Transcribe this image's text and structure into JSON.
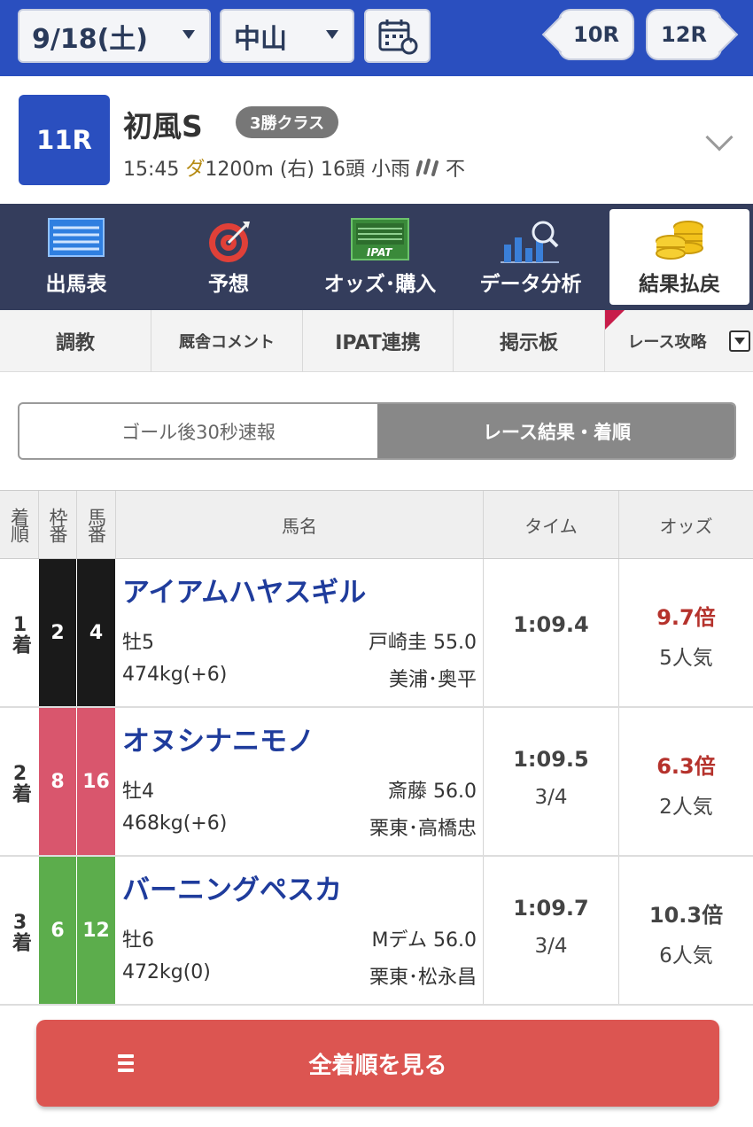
{
  "topbar": {
    "date": "9/18(土)",
    "venue": "中山",
    "prev_race": "10R",
    "next_race": "12R",
    "calendar_icon": "calendar-refresh-icon"
  },
  "race": {
    "number": "11R",
    "name": "初風S",
    "class": "3勝クラス",
    "time": "15:45",
    "surface": "ダ",
    "distance": "1200m (右)",
    "runners": "16頭",
    "weather": "小雨",
    "weather_icon": "rain-icon",
    "track": "不"
  },
  "main_nav": [
    {
      "label": "出馬表",
      "icon": "entry-table-icon"
    },
    {
      "label": "予想",
      "icon": "target-icon"
    },
    {
      "label": "オッズ･購入",
      "icon": "ipat-icon"
    },
    {
      "label": "データ分析",
      "icon": "chart-magnifier-icon"
    },
    {
      "label": "結果払戻",
      "icon": "coins-icon",
      "active": true
    }
  ],
  "sub_nav": [
    "調教",
    "厩舎コメント",
    "IPAT連携",
    "掲示板",
    "レース攻略"
  ],
  "toggle": {
    "left": "ゴール後30秒速報",
    "right": "レース結果・着順"
  },
  "table": {
    "headers": {
      "position": "着順",
      "waku": "枠番",
      "umaban": "馬番",
      "horse": "馬名",
      "time": "タイム",
      "odds": "オッズ"
    },
    "rows": [
      {
        "position": "1着",
        "waku": "2",
        "umaban": "4",
        "horse": "アイアムハヤスギル",
        "sex_age": "牡5",
        "weight": "474kg(+6)",
        "jockey": "戸崎圭 55.0",
        "trainer": "美浦･奥平",
        "time": "1:09.4",
        "margin": "",
        "odds": "9.7倍",
        "popularity": "5人気"
      },
      {
        "position": "2着",
        "waku": "8",
        "umaban": "16",
        "horse": "オヌシナニモノ",
        "sex_age": "牡4",
        "weight": "468kg(+6)",
        "jockey": "斎藤 56.0",
        "trainer": "栗東･高橋忠",
        "time": "1:09.5",
        "margin": "3/4",
        "odds": "6.3倍",
        "popularity": "2人気"
      },
      {
        "position": "3着",
        "waku": "6",
        "umaban": "12",
        "horse": "バーニングペスカ",
        "sex_age": "牡6",
        "weight": "472kg(0)",
        "jockey": "Mデム 56.0",
        "trainer": "栗東･松永昌",
        "time": "1:09.7",
        "margin": "3/4",
        "odds": "10.3倍",
        "popularity": "6人気"
      }
    ]
  },
  "colors": {
    "waku_2": "#1a1a1a",
    "waku_8": "#d9566d",
    "waku_6": "#5cad4c",
    "odds_highlight": "#b5322c",
    "odds_normal": "#444444",
    "brand_blue": "#2a4fbf",
    "button_red": "#dc5551"
  },
  "footer": {
    "all_results_button": "全着順を見る"
  }
}
